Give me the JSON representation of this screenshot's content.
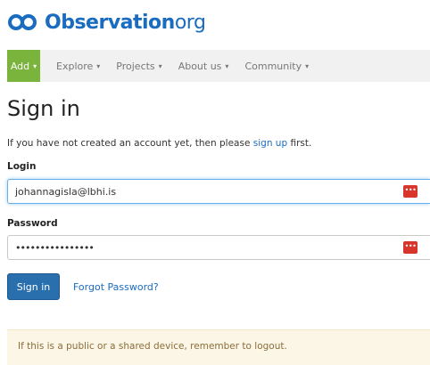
{
  "header": {
    "brand": "Observation",
    "tld": "org"
  },
  "nav": {
    "items": [
      {
        "label": "Add"
      },
      {
        "label": "Explore"
      },
      {
        "label": "Projects"
      },
      {
        "label": "About us"
      },
      {
        "label": "Community"
      }
    ],
    "caret": "▾"
  },
  "page": {
    "title": "Sign in",
    "intro_before": "If you have not created an account yet, then please ",
    "intro_link": "sign up",
    "intro_after": " first."
  },
  "form": {
    "login_label": "Login",
    "login_value": "johannagisla@lbhi.is",
    "password_label": "Password",
    "password_value": "••••••••••••••••",
    "password_manager_icon": "•••",
    "submit_label": "Sign in",
    "forgot_label": "Forgot Password?"
  },
  "notice": {
    "text": "If this is a public or a shared device, remember to logout."
  },
  "colors": {
    "brand": "#1a6cc0",
    "add_button": "#7ab43c",
    "primary_button": "#2a6fad",
    "password_manager": "#d9362b",
    "notice_bg": "#fcf6e6"
  }
}
